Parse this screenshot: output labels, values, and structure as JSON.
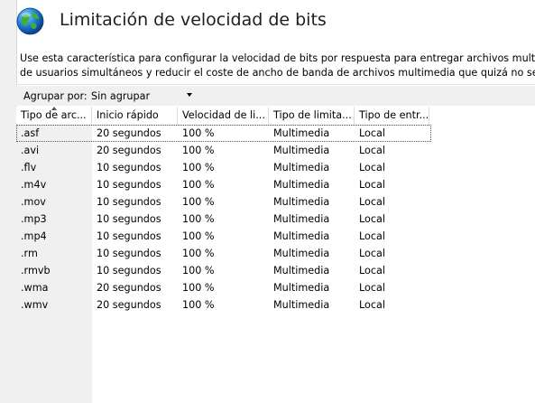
{
  "page": {
    "title": "Limitación de velocidad de bits",
    "description_line1": "Use esta característica para configurar la velocidad de bits por respuesta para entregar archivos multimedia o",
    "description_line2": "de usuarios simultáneos y reducir el coste de ancho de banda de archivos multimedia que quizá no se puedan"
  },
  "group": {
    "label": "Agrupar por:",
    "value": "Sin agrupar"
  },
  "table": {
    "headers": [
      "Tipo de arc...",
      "Inicio rápido",
      "Velocidad de li...",
      "Tipo de limita...",
      "Tipo de entr..."
    ],
    "rows": [
      [
        ".asf",
        "20 segundos",
        "100 %",
        "Multimedia",
        "Local"
      ],
      [
        ".avi",
        "20 segundos",
        "100 %",
        "Multimedia",
        "Local"
      ],
      [
        ".flv",
        "10 segundos",
        "100 %",
        "Multimedia",
        "Local"
      ],
      [
        ".m4v",
        "10 segundos",
        "100 %",
        "Multimedia",
        "Local"
      ],
      [
        ".mov",
        "10 segundos",
        "100 %",
        "Multimedia",
        "Local"
      ],
      [
        ".mp3",
        "10 segundos",
        "100 %",
        "Multimedia",
        "Local"
      ],
      [
        ".mp4",
        "10 segundos",
        "100 %",
        "Multimedia",
        "Local"
      ],
      [
        ".rm",
        "10 segundos",
        "100 %",
        "Multimedia",
        "Local"
      ],
      [
        ".rmvb",
        "10 segundos",
        "100 %",
        "Multimedia",
        "Local"
      ],
      [
        ".wma",
        "20 segundos",
        "100 %",
        "Multimedia",
        "Local"
      ],
      [
        ".wmv",
        "20 segundos",
        "100 %",
        "Multimedia",
        "Local"
      ]
    ]
  }
}
